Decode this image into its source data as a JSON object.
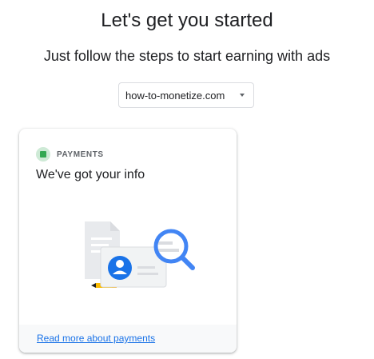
{
  "header": {
    "title": "Let's get you started",
    "subtitle": "Just follow the steps to start earning with ads"
  },
  "site_selector": {
    "selected": "how-to-monetize.com",
    "icon": "chevron-down-icon"
  },
  "card": {
    "tag": "PAYMENTS",
    "status": "complete",
    "status_color": "#34a853",
    "heading": "We've got your info",
    "illustration": "payments-documents-magnifier",
    "link_label": "Read more about payments",
    "link_color": "#1a73e8"
  }
}
